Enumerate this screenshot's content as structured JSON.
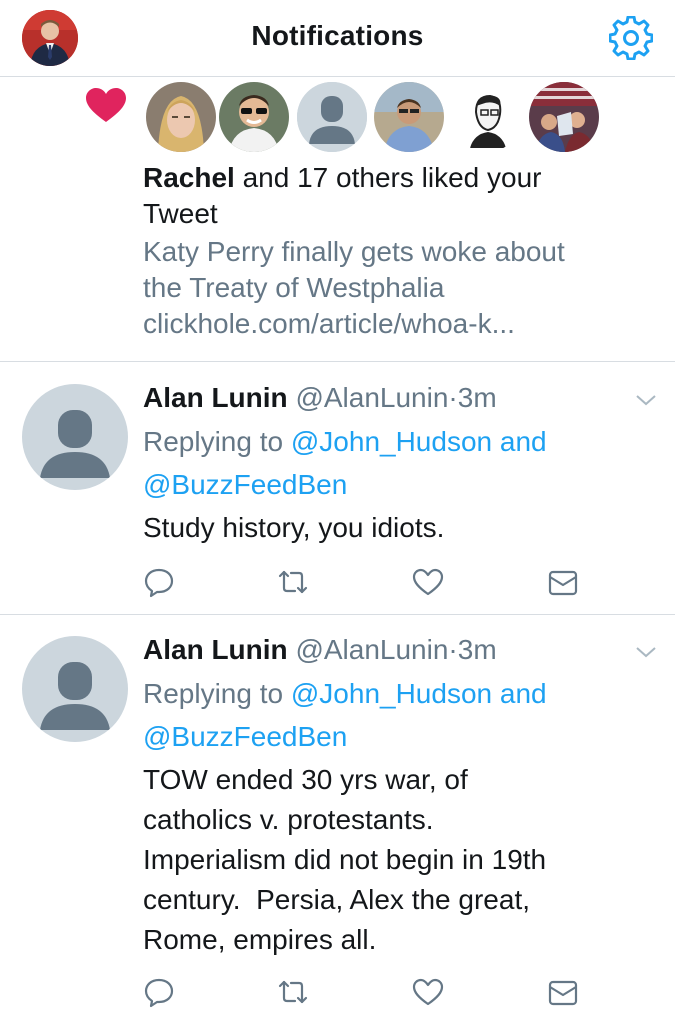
{
  "header": {
    "title": "Notifications",
    "gear_icon": "gear-icon",
    "accent": "#1da1f2"
  },
  "likes": {
    "icon": "heart-icon",
    "heart_color": "#e0245e",
    "liker_name": "Rachel",
    "summary_rest": " and 17 others liked your Tweet",
    "tweet_line_1": "Katy Perry finally gets woke about",
    "tweet_line_2": "the Treaty of Westphalia",
    "tweet_line_3": "clickhole.com/article/whoa-k..."
  },
  "tweets": [
    {
      "name": "Alan Lunin",
      "handle": "@AlanLunin",
      "dot": "·",
      "time": "3m",
      "replying_label": "Replying to ",
      "reply_user_1": "@John_Hudson",
      "reply_and": " and",
      "reply_user_2": "@BuzzFeedBen",
      "text_lines": [
        "Study history, you idiots."
      ]
    },
    {
      "name": "Alan Lunin",
      "handle": "@AlanLunin",
      "dot": "·",
      "time": "3m",
      "replying_label": "Replying to ",
      "reply_user_1": "@John_Hudson",
      "reply_and": " and",
      "reply_user_2": "@BuzzFeedBen",
      "text_lines": [
        "TOW ended 30 yrs war, of",
        "catholics v. protestants.",
        "Imperialism did not begin in 19th",
        "century.  Persia, Alex the great,",
        "Rome, empires all."
      ]
    }
  ],
  "action_icons": [
    "reply-icon",
    "retweet-icon",
    "like-icon",
    "message-icon"
  ]
}
